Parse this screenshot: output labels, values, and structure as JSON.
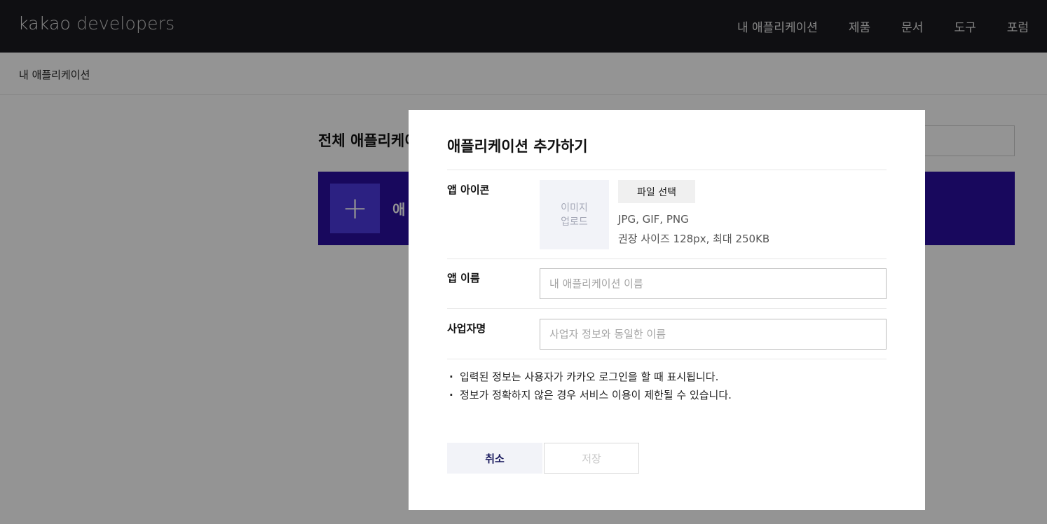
{
  "header": {
    "logo_main": "kakao",
    "logo_sub": "developers",
    "nav": [
      "내 애플리케이션",
      "제품",
      "문서",
      "도구",
      "포럼"
    ]
  },
  "subheader": {
    "breadcrumb": "내 애플리케이션"
  },
  "background": {
    "section_title": "전체 애플리케이",
    "add_card_label": "애",
    "add_card_icon": "plus-icon"
  },
  "modal": {
    "title": "애플리케이션 추가하기",
    "app_icon": {
      "label": "앱 아이콘",
      "upload_line1": "이미지",
      "upload_line2": "업로드",
      "file_button": "파일 선택",
      "hint_formats": "JPG, GIF, PNG",
      "hint_size": "권장 사이즈 128px, 최대 250KB"
    },
    "app_name": {
      "label": "앱 이름",
      "placeholder": "내 애플리케이션 이름",
      "value": ""
    },
    "company_name": {
      "label": "사업자명",
      "placeholder": "사업자 정보와 동일한 이름",
      "value": ""
    },
    "notices": [
      "입력된 정보는 사용자가 카카오 로그인을 할 때 표시됩니다.",
      "정보가 정확하지 않은 경우 서비스 이용이 제한될 수 있습니다."
    ],
    "cancel_label": "취소",
    "save_label": "저장"
  },
  "colors": {
    "topbar_bg": "#1b1b1f",
    "accent_card": "#2a0fa0",
    "cancel_text": "#1a1a5e"
  }
}
